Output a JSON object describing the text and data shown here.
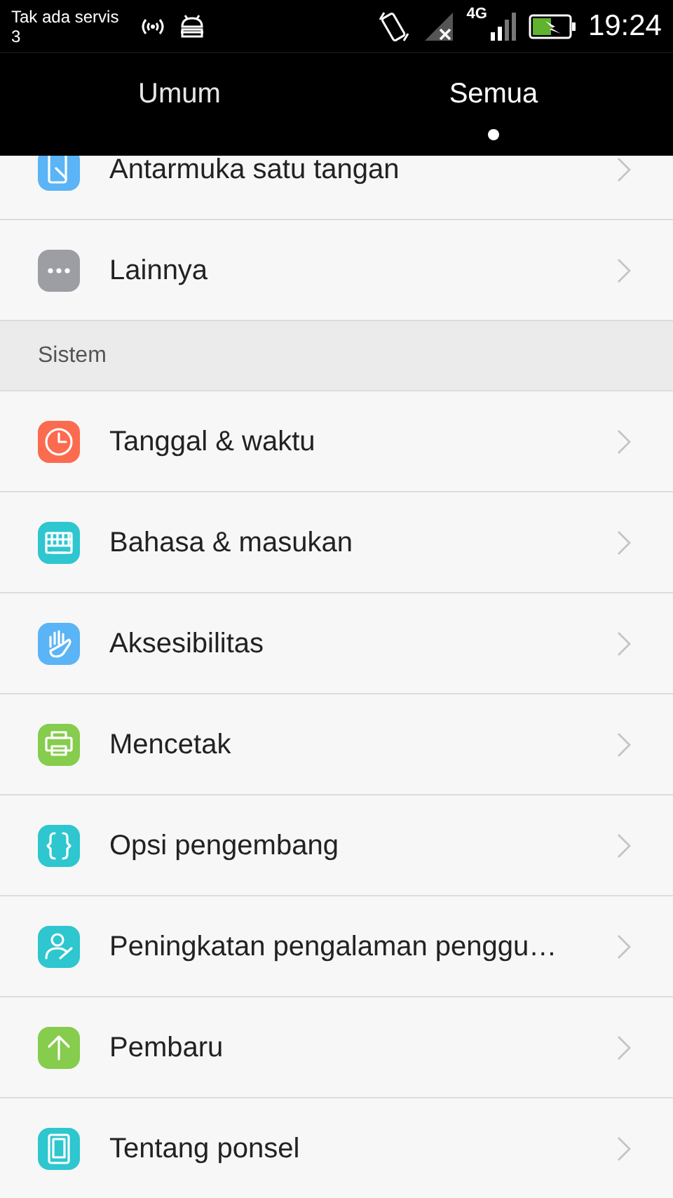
{
  "status_bar": {
    "carrier": "Tak ada servis",
    "carrier_line_2": "3",
    "network_type": "4G",
    "time": "19:24"
  },
  "tabs": [
    {
      "label": "Umum",
      "selected": false
    },
    {
      "label": "Semua",
      "selected": true
    }
  ],
  "groups": [
    {
      "items": [
        {
          "label": "Antarmuka satu tangan",
          "kind": "hand-phone",
          "color": "#5ab4f5"
        },
        {
          "label": "Lainnya",
          "kind": "dots",
          "color": "#9d9ea3"
        }
      ]
    },
    {
      "header": "Sistem",
      "items": [
        {
          "label": "Tanggal & waktu",
          "kind": "clock",
          "color": "#fb6b4f"
        },
        {
          "label": "Bahasa & masukan",
          "kind": "keyboard",
          "color": "#2ec6cf"
        },
        {
          "label": "Aksesibilitas",
          "kind": "hand",
          "color": "#5ab4f5"
        },
        {
          "label": "Mencetak",
          "kind": "printer",
          "color": "#86cc4d"
        },
        {
          "label": "Opsi pengembang",
          "kind": "braces",
          "color": "#2ec6cf"
        },
        {
          "label": "Peningkatan pengalaman penggu…",
          "kind": "person",
          "color": "#2ec6cf"
        },
        {
          "label": "Pembaru",
          "kind": "arrow-up",
          "color": "#86cc4d"
        },
        {
          "label": "Tentang ponsel",
          "kind": "phone",
          "color": "#2ec6cf"
        }
      ]
    }
  ]
}
